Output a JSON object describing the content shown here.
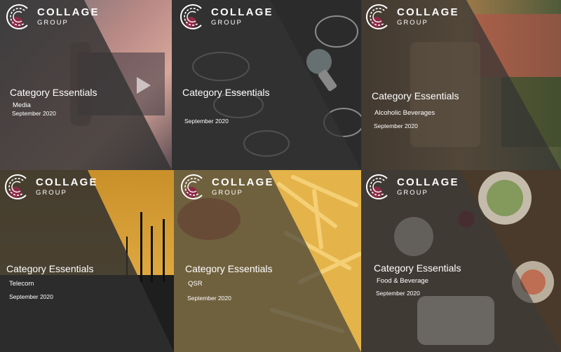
{
  "brand": {
    "word1": "COLLAGE",
    "word2": "GROUP"
  },
  "tiles": [
    {
      "title": "Category Essentials",
      "subtitle": "Media",
      "date": "September 2020"
    },
    {
      "title": "Category Essentials",
      "subtitle": "",
      "date": "September 2020"
    },
    {
      "title": "Category Essentials",
      "subtitle": "Alcoholic Beverages",
      "date": "September 2020"
    },
    {
      "title": "Category Essentials",
      "subtitle": "Telecom",
      "date": "September 2020"
    },
    {
      "title": "Category Essentials",
      "subtitle": "QSR",
      "date": "September 2020"
    },
    {
      "title": "Category Essentials",
      "subtitle": "Food & Beverage",
      "date": "September 2020"
    }
  ],
  "colors": {
    "overlay": "#2e2e2e",
    "accent": "#8b2a45"
  }
}
